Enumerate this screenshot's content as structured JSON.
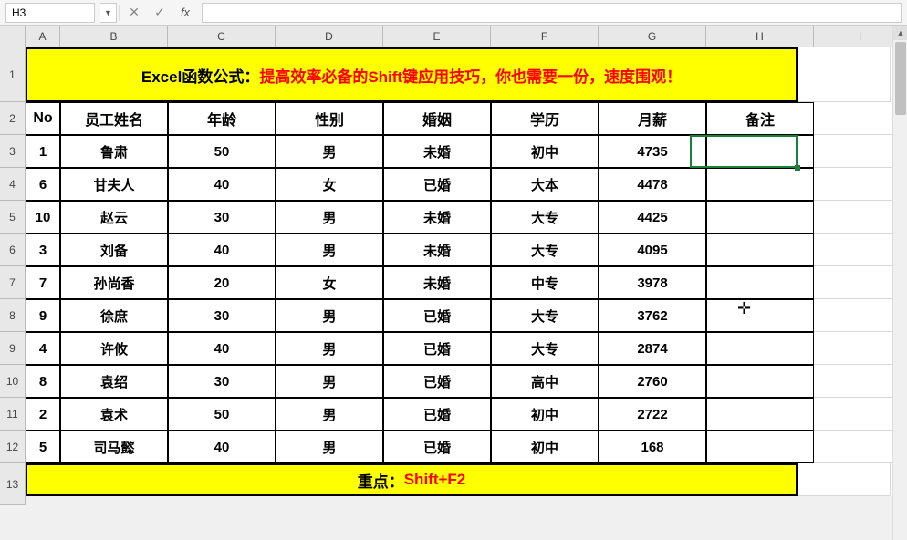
{
  "name_box": "H3",
  "formula_value": "",
  "col_letters": [
    "A",
    "B",
    "C",
    "D",
    "E",
    "F",
    "G",
    "H",
    "I"
  ],
  "row_numbers": [
    "1",
    "2",
    "3",
    "4",
    "5",
    "6",
    "7",
    "8",
    "9",
    "10",
    "11",
    "12",
    "13"
  ],
  "banner": {
    "part1": "Excel函数公式：",
    "part2": "提高效率必备的Shift键应用技巧，你也需要一份，速度围观！"
  },
  "headers": {
    "no": "No",
    "name": "员工姓名",
    "age": "年龄",
    "gender": "性别",
    "marriage": "婚姻",
    "edu": "学历",
    "salary": "月薪",
    "remark": "备注"
  },
  "rows": [
    {
      "no": "1",
      "name": "鲁肃",
      "age": "50",
      "gender": "男",
      "marriage": "未婚",
      "edu": "初中",
      "salary": "4735",
      "remark": ""
    },
    {
      "no": "6",
      "name": "甘夫人",
      "age": "40",
      "gender": "女",
      "marriage": "已婚",
      "edu": "大本",
      "salary": "4478",
      "remark": ""
    },
    {
      "no": "10",
      "name": "赵云",
      "age": "30",
      "gender": "男",
      "marriage": "未婚",
      "edu": "大专",
      "salary": "4425",
      "remark": ""
    },
    {
      "no": "3",
      "name": "刘备",
      "age": "40",
      "gender": "男",
      "marriage": "未婚",
      "edu": "大专",
      "salary": "4095",
      "remark": ""
    },
    {
      "no": "7",
      "name": "孙尚香",
      "age": "20",
      "gender": "女",
      "marriage": "未婚",
      "edu": "中专",
      "salary": "3978",
      "remark": ""
    },
    {
      "no": "9",
      "name": "徐庶",
      "age": "30",
      "gender": "男",
      "marriage": "已婚",
      "edu": "大专",
      "salary": "3762",
      "remark": ""
    },
    {
      "no": "4",
      "name": "许攸",
      "age": "40",
      "gender": "男",
      "marriage": "已婚",
      "edu": "大专",
      "salary": "2874",
      "remark": ""
    },
    {
      "no": "8",
      "name": "袁绍",
      "age": "30",
      "gender": "男",
      "marriage": "已婚",
      "edu": "高中",
      "salary": "2760",
      "remark": ""
    },
    {
      "no": "2",
      "name": "袁术",
      "age": "50",
      "gender": "男",
      "marriage": "已婚",
      "edu": "初中",
      "salary": "2722",
      "remark": ""
    },
    {
      "no": "5",
      "name": "司马懿",
      "age": "40",
      "gender": "男",
      "marriage": "已婚",
      "edu": "初中",
      "salary": "168",
      "remark": ""
    }
  ],
  "footer": {
    "part1": "重点：",
    "part2": "Shift+F2"
  },
  "active_cell": "H3",
  "chart_data": {
    "type": "table",
    "title": "Excel函数公式：提高效率必备的Shift键应用技巧，你也需要一份，速度围观！",
    "columns": [
      "No",
      "员工姓名",
      "年龄",
      "性别",
      "婚姻",
      "学历",
      "月薪",
      "备注"
    ],
    "data": [
      [
        1,
        "鲁肃",
        50,
        "男",
        "未婚",
        "初中",
        4735,
        ""
      ],
      [
        6,
        "甘夫人",
        40,
        "女",
        "已婚",
        "大本",
        4478,
        ""
      ],
      [
        10,
        "赵云",
        30,
        "男",
        "未婚",
        "大专",
        4425,
        ""
      ],
      [
        3,
        "刘备",
        40,
        "男",
        "未婚",
        "大专",
        4095,
        ""
      ],
      [
        7,
        "孙尚香",
        20,
        "女",
        "未婚",
        "中专",
        3978,
        ""
      ],
      [
        9,
        "徐庶",
        30,
        "男",
        "已婚",
        "大专",
        3762,
        ""
      ],
      [
        4,
        "许攸",
        40,
        "男",
        "已婚",
        "大专",
        2874,
        ""
      ],
      [
        8,
        "袁绍",
        30,
        "男",
        "已婚",
        "高中",
        2760,
        ""
      ],
      [
        2,
        "袁术",
        50,
        "男",
        "已婚",
        "初中",
        2722,
        ""
      ],
      [
        5,
        "司马懿",
        40,
        "男",
        "已婚",
        "初中",
        168,
        ""
      ]
    ],
    "footer": "重点：Shift+F2"
  }
}
